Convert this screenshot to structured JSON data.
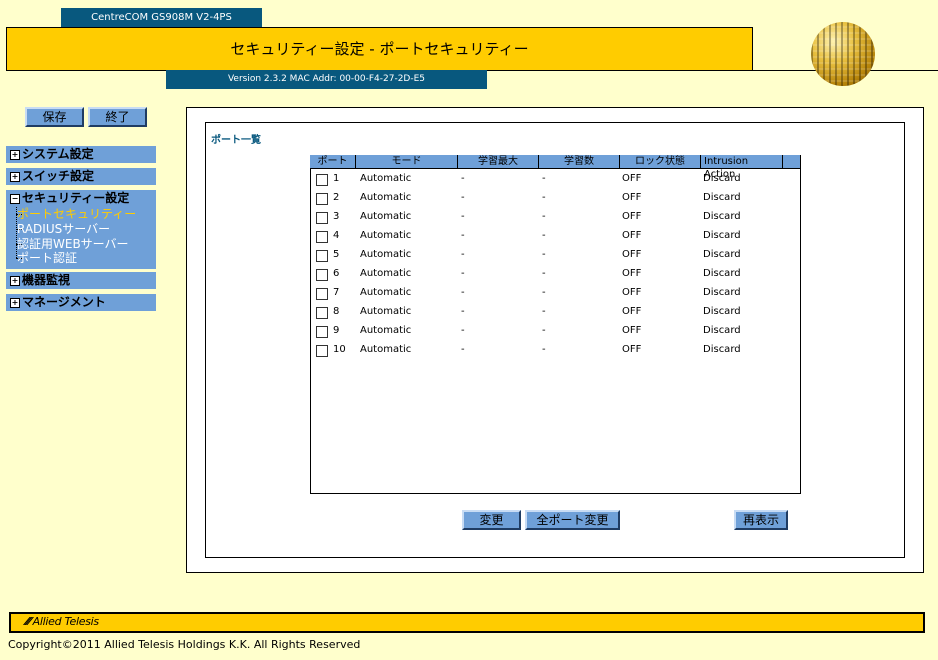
{
  "header": {
    "model": "CentreCOM GS908M V2-4PS",
    "page_title": "セキュリティー設定 - ポートセキュリティー",
    "version": "Version 2.3.2 MAC Addr: 00-00-F4-27-2D-E5"
  },
  "toolbar": {
    "save_label": "保存",
    "exit_label": "終了"
  },
  "menu": {
    "system": "システム設定",
    "switch": "スイッチ設定",
    "security": "セキュリティー設定",
    "security_items": [
      "ポートセキュリティー",
      "RADIUSサーバー",
      "認証用WEBサーバー",
      "ポート認証"
    ],
    "monitor": "機器監視",
    "management": "マネージメント",
    "expand_symbol": "+",
    "collapse_symbol": "−"
  },
  "main": {
    "section_title": "ポート一覧",
    "columns": [
      "ポート",
      "モード",
      "学習最大",
      "学習数",
      "ロック状態",
      "Intrusion Action"
    ],
    "rows": [
      {
        "port": "1",
        "mode": "Automatic",
        "max": "-",
        "count": "-",
        "lock": "OFF",
        "action": "Discard"
      },
      {
        "port": "2",
        "mode": "Automatic",
        "max": "-",
        "count": "-",
        "lock": "OFF",
        "action": "Discard"
      },
      {
        "port": "3",
        "mode": "Automatic",
        "max": "-",
        "count": "-",
        "lock": "OFF",
        "action": "Discard"
      },
      {
        "port": "4",
        "mode": "Automatic",
        "max": "-",
        "count": "-",
        "lock": "OFF",
        "action": "Discard"
      },
      {
        "port": "5",
        "mode": "Automatic",
        "max": "-",
        "count": "-",
        "lock": "OFF",
        "action": "Discard"
      },
      {
        "port": "6",
        "mode": "Automatic",
        "max": "-",
        "count": "-",
        "lock": "OFF",
        "action": "Discard"
      },
      {
        "port": "7",
        "mode": "Automatic",
        "max": "-",
        "count": "-",
        "lock": "OFF",
        "action": "Discard"
      },
      {
        "port": "8",
        "mode": "Automatic",
        "max": "-",
        "count": "-",
        "lock": "OFF",
        "action": "Discard"
      },
      {
        "port": "9",
        "mode": "Automatic",
        "max": "-",
        "count": "-",
        "lock": "OFF",
        "action": "Discard"
      },
      {
        "port": "10",
        "mode": "Automatic",
        "max": "-",
        "count": "-",
        "lock": "OFF",
        "action": "Discard"
      }
    ],
    "buttons": {
      "change": "変更",
      "change_all": "全ポート変更",
      "refresh": "再表示"
    }
  },
  "footer": {
    "brand": "Allied Telesis",
    "copyright": "Copyright©2011 Allied Telesis Holdings K.K. All Rights Reserved"
  },
  "colors": {
    "background": "#ffffcc",
    "accent_yellow": "#ffcc00",
    "header_blue": "#08587e",
    "menu_blue": "#6fa0d8",
    "active_item": "#ffcc00"
  },
  "icons": {
    "logo": "globe-logo-icon",
    "brand": "allied-telesis-logo-icon"
  }
}
